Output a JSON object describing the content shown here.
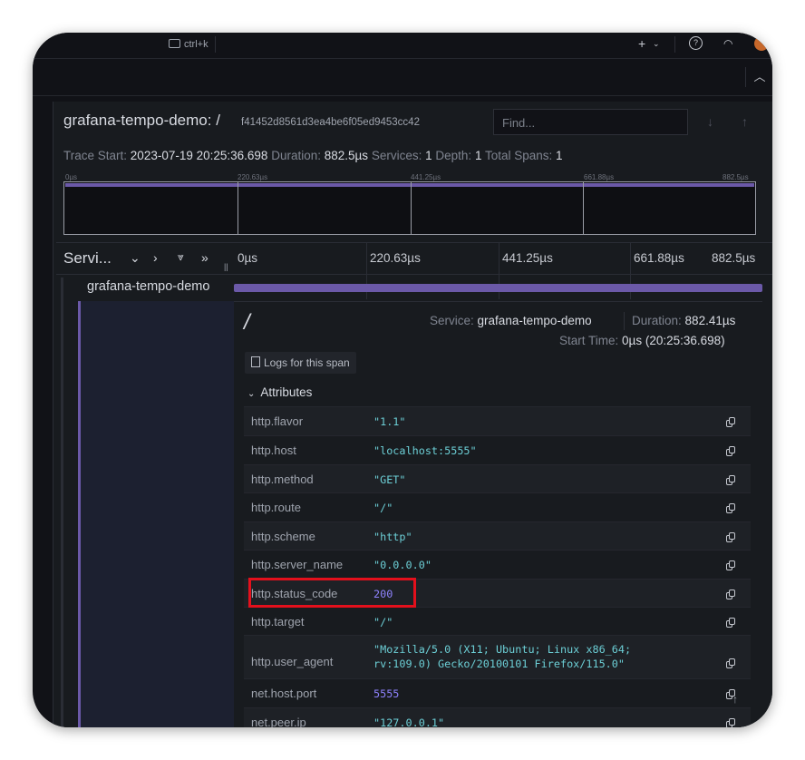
{
  "topbar": {
    "shortcut": "ctrl+k",
    "add_icon": "plus-icon",
    "add_caret": "chevron-down-icon",
    "help_icon": "help-circle-icon",
    "feed_icon": "rss-icon"
  },
  "header": {
    "service": "grafana-tempo-demo:",
    "operation": "/",
    "trace_id": "f41452d8561d3ea4be6f05ed9453cc42",
    "find_placeholder": "Find..."
  },
  "summary": {
    "trace_start_label": "Trace Start:",
    "trace_start_value": "2023-07-19 20:25:36.698",
    "duration_label": "Duration:",
    "duration_value": "882.5µs",
    "services_label": "Services:",
    "services_value": "1",
    "depth_label": "Depth:",
    "depth_value": "1",
    "total_spans_label": "Total Spans:",
    "total_spans_value": "1"
  },
  "minimap_ticks": [
    "0µs",
    "220.63µs",
    "441.25µs",
    "661.88µs",
    "882.5µs"
  ],
  "timeline_header": {
    "label": "Servi...",
    "ticks": [
      "0µs",
      "220.63µs",
      "441.25µs",
      "661.88µs",
      "882.5µs"
    ]
  },
  "span": {
    "service": "grafana-tempo-demo",
    "operation": "/",
    "service_label": "Service:",
    "service_value": "grafana-tempo-demo",
    "duration_label": "Duration:",
    "duration_value": "882.41µs",
    "start_label": "Start Time:",
    "start_value": "0µs (20:25:36.698)",
    "logs_button": "Logs for this span",
    "attributes_label": "Attributes",
    "attributes": [
      {
        "key": "http.flavor",
        "value": "\"1.1\""
      },
      {
        "key": "http.host",
        "value": "\"localhost:5555\""
      },
      {
        "key": "http.method",
        "value": "\"GET\""
      },
      {
        "key": "http.route",
        "value": "\"/\""
      },
      {
        "key": "http.scheme",
        "value": "\"http\""
      },
      {
        "key": "http.server_name",
        "value": "\"0.0.0.0\""
      },
      {
        "key": "http.status_code",
        "value": "200"
      },
      {
        "key": "http.target",
        "value": "\"/\""
      },
      {
        "key": "http.user_agent",
        "value": "\"Mozilla/5.0 (X11; Ubuntu; Linux x86_64;\nrv:109.0) Gecko/20100101 Firefox/115.0\""
      },
      {
        "key": "net.host.port",
        "value": "5555"
      },
      {
        "key": "net.peer.ip",
        "value": "\"127.0.0.1\""
      }
    ]
  },
  "colors": {
    "span_bar": "#6b59a8",
    "string_value": "#6ccfd6",
    "number_value": "#8f83ff",
    "highlight": "#e3101c"
  }
}
